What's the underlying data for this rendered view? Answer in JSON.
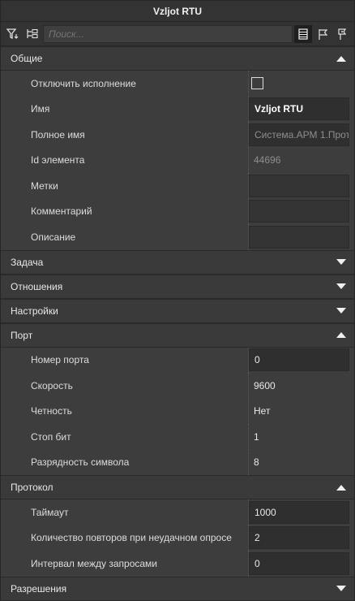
{
  "title": "Vzljot RTU",
  "toolbar": {
    "search_placeholder": "Поиск...",
    "icons": [
      "filter-icon",
      "tree-filter-icon",
      "list-view-icon",
      "flag-icon",
      "flag-filter-icon"
    ]
  },
  "sections": [
    {
      "title": "Общие",
      "expanded": true,
      "rows": [
        {
          "label": "Отключить исполнение",
          "kind": "checkbox",
          "checked": false
        },
        {
          "label": "Имя",
          "kind": "box",
          "style": "bold",
          "value": "Vzljot RTU"
        },
        {
          "label": "Полное имя",
          "kind": "box",
          "style": "muted",
          "value": "Система.АРМ 1.Прот"
        },
        {
          "label": "Id элемента",
          "kind": "text-muted",
          "value": "44696"
        },
        {
          "label": "Метки",
          "kind": "box",
          "style": "empty",
          "value": ""
        },
        {
          "label": "Комментарий",
          "kind": "box",
          "style": "empty",
          "value": ""
        },
        {
          "label": "Описание",
          "kind": "box",
          "style": "empty",
          "value": ""
        }
      ]
    },
    {
      "title": "Задача",
      "expanded": false,
      "rows": []
    },
    {
      "title": "Отношения",
      "expanded": false,
      "rows": []
    },
    {
      "title": "Настройки",
      "expanded": false,
      "rows": []
    },
    {
      "title": "Порт",
      "expanded": true,
      "rows": [
        {
          "label": "Номер порта",
          "kind": "box",
          "style": "normal",
          "value": "0"
        },
        {
          "label": "Скорость",
          "kind": "text",
          "value": "9600"
        },
        {
          "label": "Четность",
          "kind": "text",
          "value": "Нет"
        },
        {
          "label": "Стоп бит",
          "kind": "text",
          "value": "1"
        },
        {
          "label": "Разрядность символа",
          "kind": "text",
          "value": "8"
        }
      ]
    },
    {
      "title": "Протокол",
      "expanded": true,
      "rows": [
        {
          "label": "Таймаут",
          "kind": "box",
          "style": "normal",
          "value": "1000"
        },
        {
          "label": "Количество повторов при неудачном опросе",
          "kind": "box",
          "style": "normal",
          "value": "2"
        },
        {
          "label": "Интервал между запросами",
          "kind": "box",
          "style": "normal",
          "value": "0"
        }
      ]
    },
    {
      "title": "Разрешения",
      "expanded": false,
      "rows": []
    }
  ]
}
